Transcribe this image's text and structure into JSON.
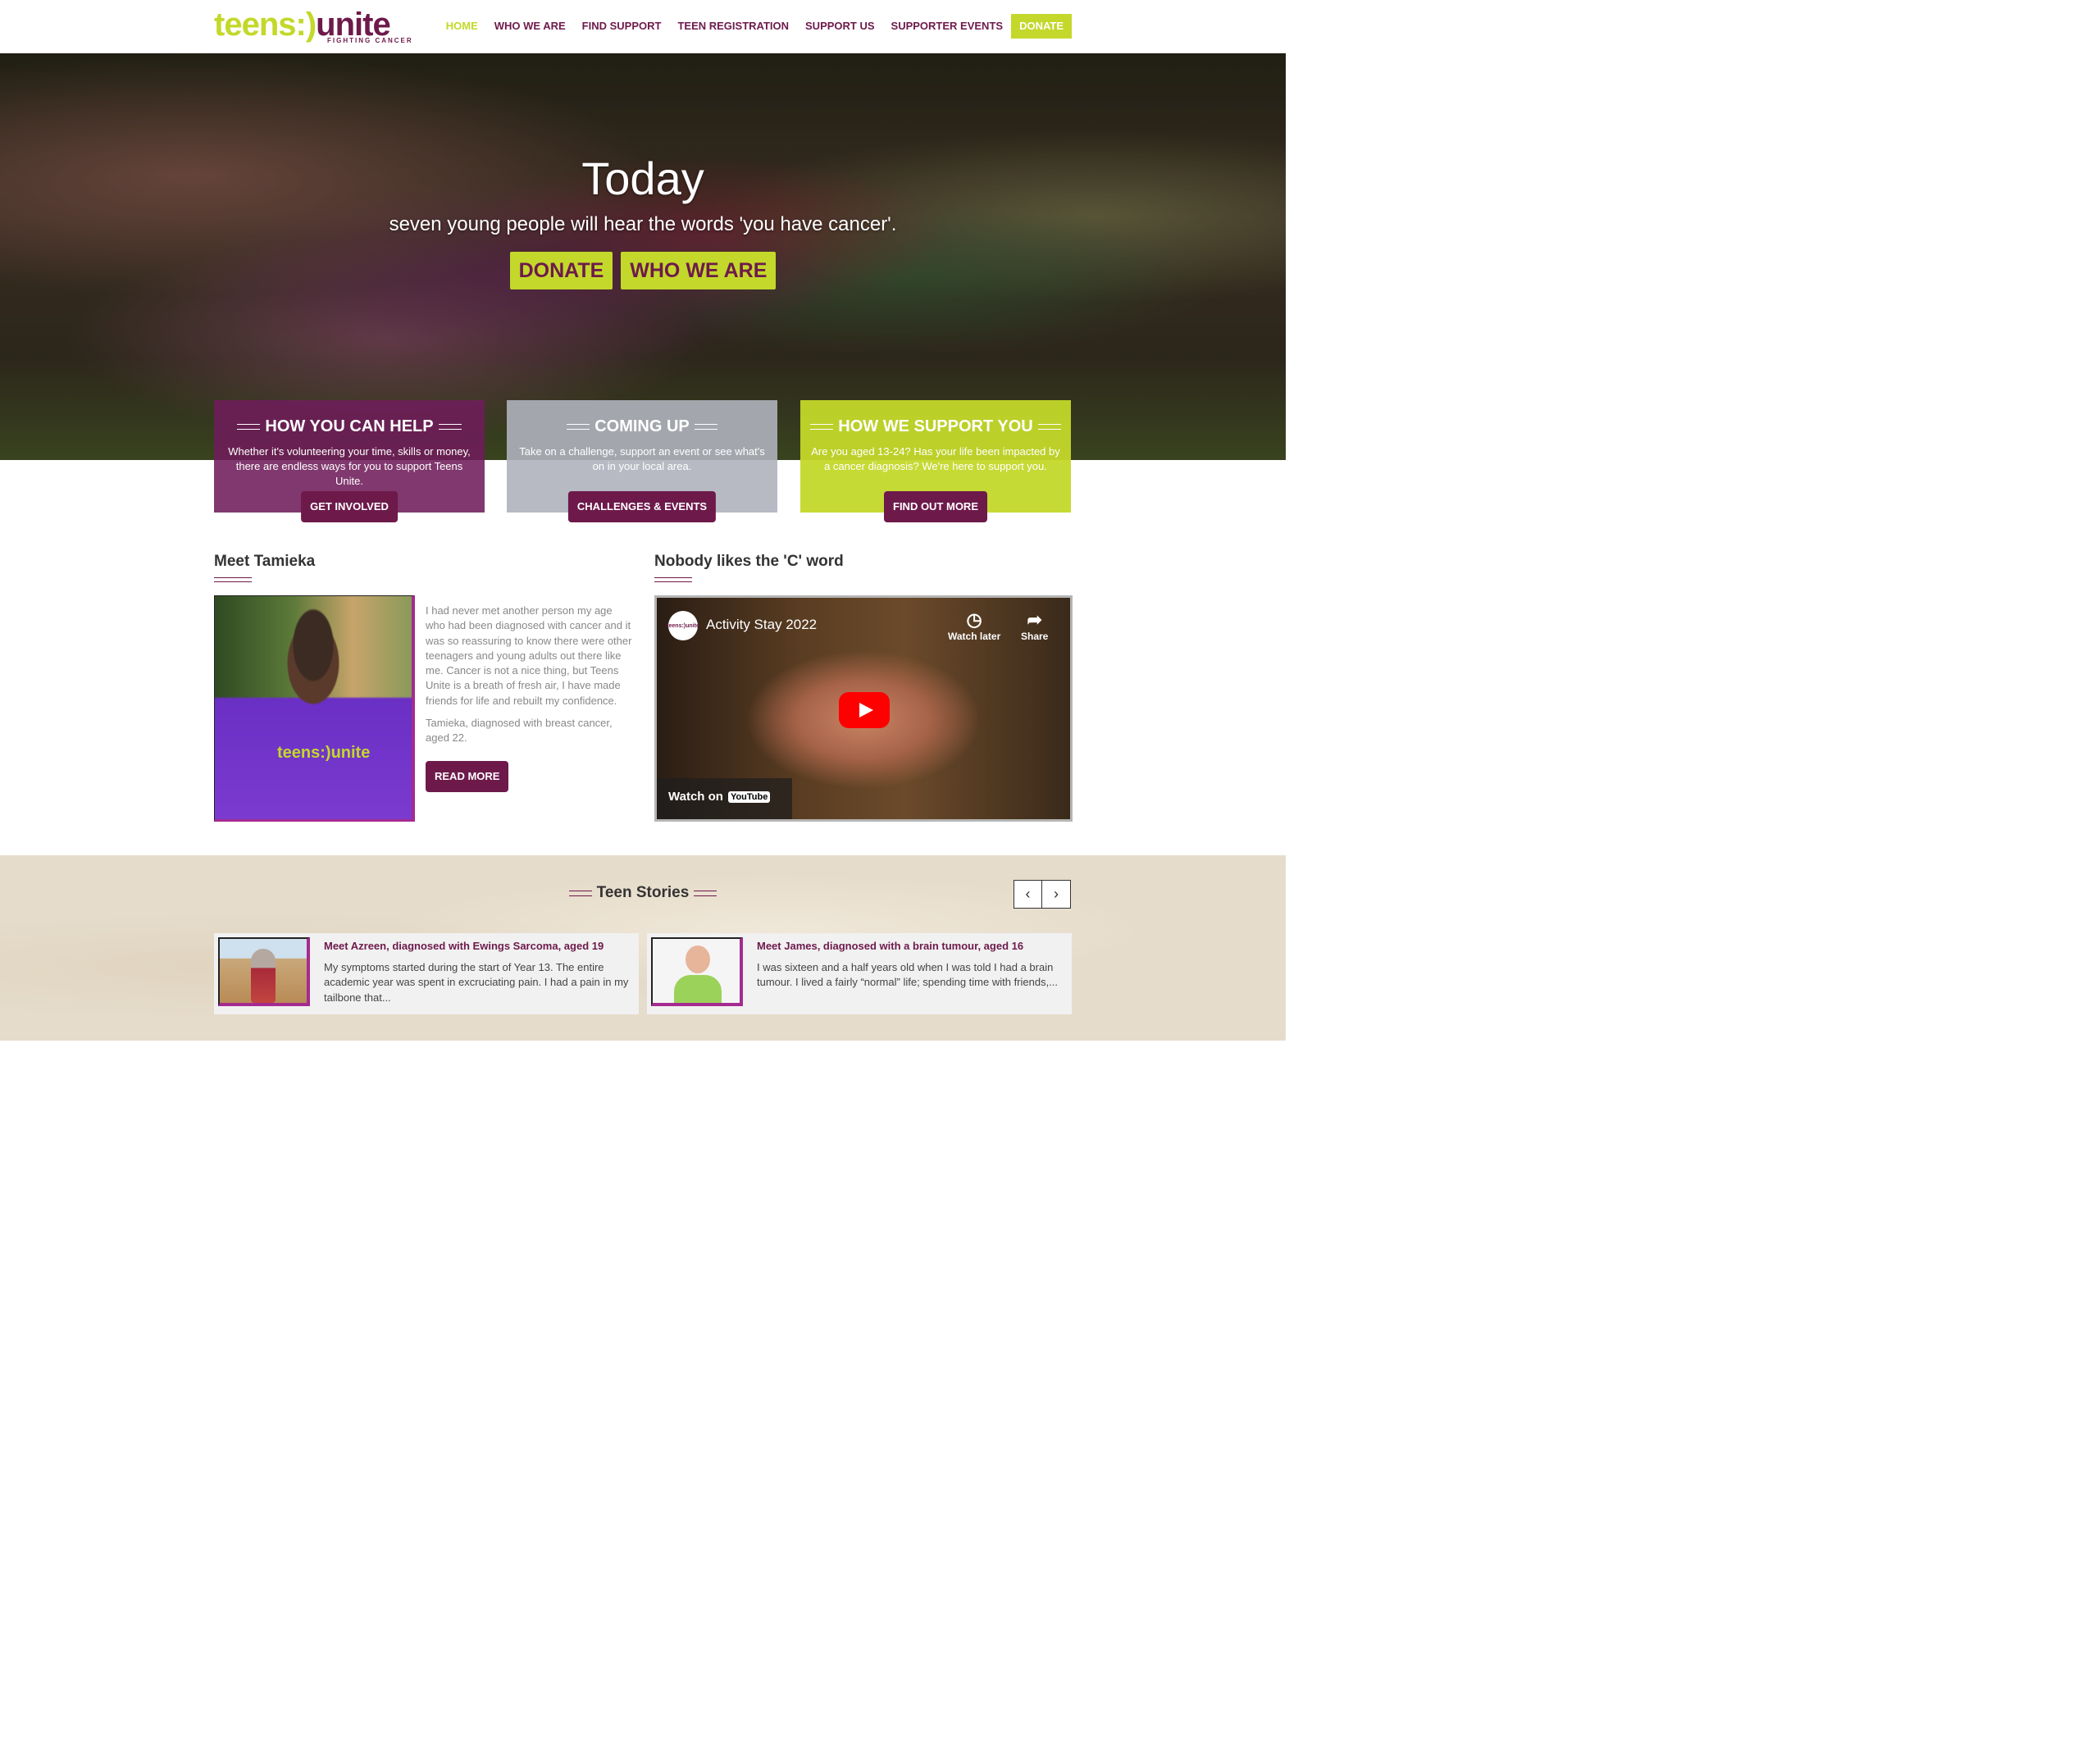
{
  "brand": {
    "logo_part1": "teens:)",
    "logo_part2": "unite",
    "logo_tagline": "FIGHTING CANCER",
    "colors": {
      "purple": "#6d1a4b",
      "lime": "#c3d82a",
      "magenta": "#a52a90"
    }
  },
  "nav": {
    "items": [
      {
        "label": "HOME"
      },
      {
        "label": "WHO WE ARE"
      },
      {
        "label": "FIND SUPPORT"
      },
      {
        "label": "TEEN REGISTRATION"
      },
      {
        "label": "SUPPORT US"
      },
      {
        "label": "SUPPORTER EVENTS"
      },
      {
        "label": "DONATE"
      }
    ]
  },
  "hero": {
    "title": "Today",
    "subtitle": "seven young people will hear the words 'you have cancer'.",
    "donate_label": "DONATE",
    "who_label": "WHO WE ARE"
  },
  "boxes": [
    {
      "title": "HOW YOU CAN HELP",
      "text": "Whether it's volunteering your time, skills or money, there are endless ways for you to support Teens Unite.",
      "button": "GET INVOLVED"
    },
    {
      "title": "COMING UP",
      "text": "Take on a challenge, support an event or see what's on in your local area.",
      "button": "CHALLENGES & EVENTS"
    },
    {
      "title": "HOW WE SUPPORT YOU",
      "text": "Are you aged 13-24? Has your life been impacted by a cancer diagnosis? We're here to support you.",
      "button": "FIND OUT MORE"
    }
  ],
  "meet": {
    "title": "Meet Tamieka",
    "photo_logo": "teens:)unite",
    "quote": "I had never met another person my age who had been diagnosed with cancer and it was so reassuring to know there were other teenagers and young adults out there like me. Cancer is not a nice thing, but Teens Unite is a breath of fresh air, I have made friends for life and rebuilt my confidence.",
    "attribution": "Tamieka, diagnosed with breast cancer, aged 22.",
    "button": "READ MORE"
  },
  "video_section": {
    "title": "Nobody likes the 'C' word",
    "video_title": "Activity Stay 2022",
    "channel_avatar": "teens:)unite",
    "watch_later": "Watch later",
    "share": "Share",
    "watch_on": "Watch on",
    "youtube": "YouTube"
  },
  "stories": {
    "title": "Teen Stories",
    "prev_icon": "‹",
    "next_icon": "›",
    "cards": [
      {
        "title": "Meet Azreen, diagnosed with Ewings Sarcoma, aged 19",
        "text": "My symptoms started during the start of Year 13. The entire academic year was spent in excruciating pain. I had a pain in my tailbone that..."
      },
      {
        "title": "Meet James, diagnosed with a brain tumour, aged 16",
        "text": "I was sixteen and a half years old when I was told I had a brain tumour. I lived a fairly “normal” life; spending time with friends,..."
      }
    ]
  }
}
